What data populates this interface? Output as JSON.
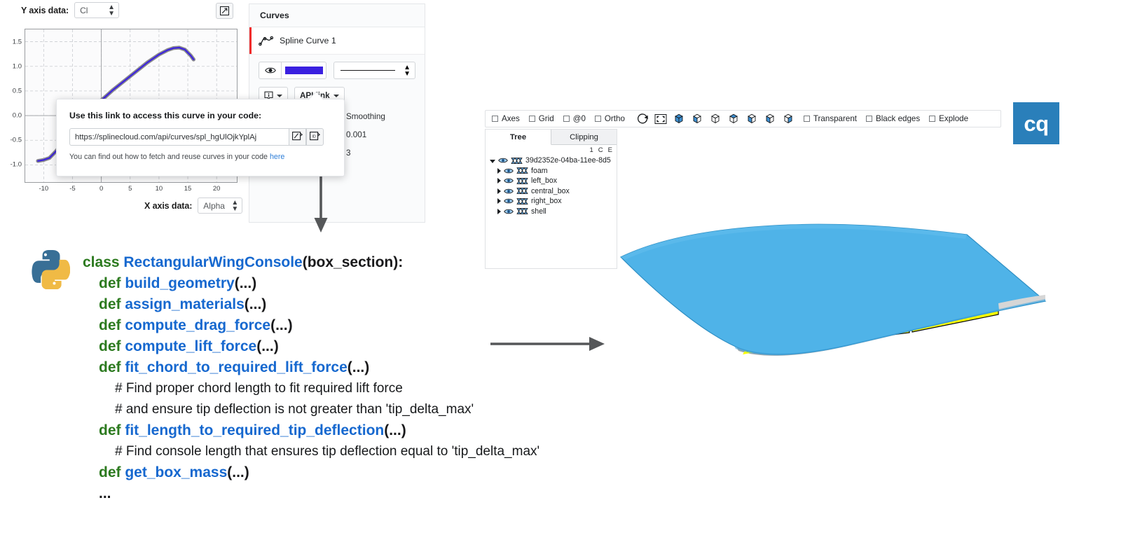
{
  "splinecloud": {
    "y_axis_label": "Y axis data:",
    "y_axis_value": "Cl",
    "x_axis_label": "X axis data:",
    "x_axis_value": "Alpha",
    "expand_icon": "expand-icon",
    "popover": {
      "title": "Use this link to access this curve in your code:",
      "url": "https://splinecloud.com/api/curves/spl_hgUlOjkYplAj",
      "copy_icon": "copy-link-icon",
      "id_icon": "copy-id-icon",
      "footer_prefix": "You can find out how to fetch and reuse curves in your code ",
      "footer_link": "here"
    },
    "curves_panel": {
      "header": "Curves",
      "curve_name": "Spline Curve 1",
      "curve_icon": "spline-curve-icon",
      "visibility_icon": "eye-icon",
      "color_hex": "#3a20e0",
      "line_style": "solid",
      "info_button": "i",
      "api_link_button": "API link",
      "properties": [
        "Smoothing",
        "0.001",
        "3"
      ]
    },
    "chart_data": {
      "type": "line",
      "title": "",
      "xlabel": "Alpha",
      "ylabel": "Cl",
      "xlim": [
        -13.2,
        23.5
      ],
      "ylim": [
        -1.35,
        1.75
      ],
      "xticks": [
        -10,
        -5,
        0,
        5,
        10,
        15,
        20
      ],
      "yticks": [
        -1.0,
        -0.5,
        0.0,
        0.5,
        1.0,
        1.5
      ],
      "grid": true,
      "legend": "none",
      "series": [
        {
          "name": "Spline Curve 1",
          "color": "#3a20e0",
          "x": [
            -11.0,
            -10.0,
            -9.0,
            -8.5,
            -8.0,
            -1.0,
            0.5,
            2.0,
            5.0,
            8.0,
            10.0,
            11.5,
            12.5,
            13.5,
            14.5,
            15.5,
            16.0
          ],
          "y": [
            -0.92,
            -0.9,
            -0.86,
            -0.8,
            -0.74,
            0.22,
            0.36,
            0.52,
            0.8,
            1.08,
            1.24,
            1.33,
            1.37,
            1.38,
            1.34,
            1.22,
            1.14
          ]
        }
      ]
    }
  },
  "code": {
    "logo_icon": "python-logo-icon",
    "lines": [
      {
        "indent": 0,
        "tokens": [
          {
            "t": "class ",
            "c": "kw"
          },
          {
            "t": "RectangularWingConsole",
            "c": "fn"
          },
          {
            "t": "(box_section):",
            "c": "pl"
          }
        ]
      },
      {
        "indent": 1,
        "tokens": [
          {
            "t": "def ",
            "c": "kw"
          },
          {
            "t": "build_geometry",
            "c": "fn"
          },
          {
            "t": "(...)",
            "c": "pl"
          }
        ]
      },
      {
        "indent": 1,
        "tokens": [
          {
            "t": "def ",
            "c": "kw"
          },
          {
            "t": "assign_materials",
            "c": "fn"
          },
          {
            "t": "(...)",
            "c": "pl"
          }
        ]
      },
      {
        "indent": 1,
        "tokens": [
          {
            "t": "def ",
            "c": "kw"
          },
          {
            "t": "compute_drag_force",
            "c": "fn"
          },
          {
            "t": "(...)",
            "c": "pl"
          }
        ]
      },
      {
        "indent": 1,
        "tokens": [
          {
            "t": "def ",
            "c": "kw"
          },
          {
            "t": "compute_lift_force",
            "c": "fn"
          },
          {
            "t": "(...)",
            "c": "pl"
          }
        ]
      },
      {
        "indent": 1,
        "tokens": [
          {
            "t": "def ",
            "c": "kw"
          },
          {
            "t": "fit_chord_to_required_lift_force",
            "c": "fn"
          },
          {
            "t": "(...)",
            "c": "pl"
          }
        ]
      },
      {
        "indent": 2,
        "tokens": [
          {
            "t": "# Find proper chord length to fit required lift force",
            "c": "cm"
          }
        ]
      },
      {
        "indent": 2,
        "tokens": [
          {
            "t": "# and ensure tip deflection is not greater than 'tip_delta_max'",
            "c": "cm"
          }
        ]
      },
      {
        "indent": 1,
        "tokens": [
          {
            "t": "def ",
            "c": "kw"
          },
          {
            "t": "fit_length_to_required_tip_deflection",
            "c": "fn"
          },
          {
            "t": "(...)",
            "c": "pl"
          }
        ]
      },
      {
        "indent": 2,
        "tokens": [
          {
            "t": "# Find console length that ensures tip deflection equal to 'tip_delta_max'",
            "c": "cm"
          }
        ]
      },
      {
        "indent": 1,
        "tokens": [
          {
            "t": "def ",
            "c": "kw"
          },
          {
            "t": "get_box_mass",
            "c": "fn"
          },
          {
            "t": "(...)",
            "c": "pl"
          }
        ]
      },
      {
        "indent": 1,
        "tokens": [
          {
            "t": "...",
            "c": "pl"
          }
        ]
      }
    ]
  },
  "viewer": {
    "toolbar": {
      "checkboxes": [
        "Axes",
        "Grid",
        "@0",
        "Ortho"
      ],
      "icons": [
        "reset-rotation-icon",
        "fit-to-screen-icon",
        "iso-view-icon",
        "front-view-icon",
        "rear-view-icon",
        "top-view-icon",
        "bottom-view-icon",
        "left-view-icon",
        "right-view-icon"
      ],
      "right_checkboxes": [
        "Transparent",
        "Black edges",
        "Explode"
      ]
    },
    "tree": {
      "tabs": [
        "Tree",
        "Clipping"
      ],
      "active_tab": "Tree",
      "column_headers": [
        "1",
        "C",
        "E"
      ],
      "root": "39d2352e-04ba-11ee-8d5",
      "children": [
        "foam",
        "left_box",
        "central_box",
        "right_box",
        "shell"
      ],
      "eye_icon": "eye-icon",
      "mesh_icon": "mesh-icon"
    },
    "model": {
      "name": "rectangular-wing-console",
      "skin_color": "#4fb3e8",
      "box_color": "#ffff00",
      "foam_color": "#b3b3b3"
    },
    "logo": {
      "text": "cq",
      "bg_hex": "#2a7fba"
    }
  },
  "arrows": {
    "vertical": "down-arrow",
    "horizontal": "right-arrow"
  }
}
